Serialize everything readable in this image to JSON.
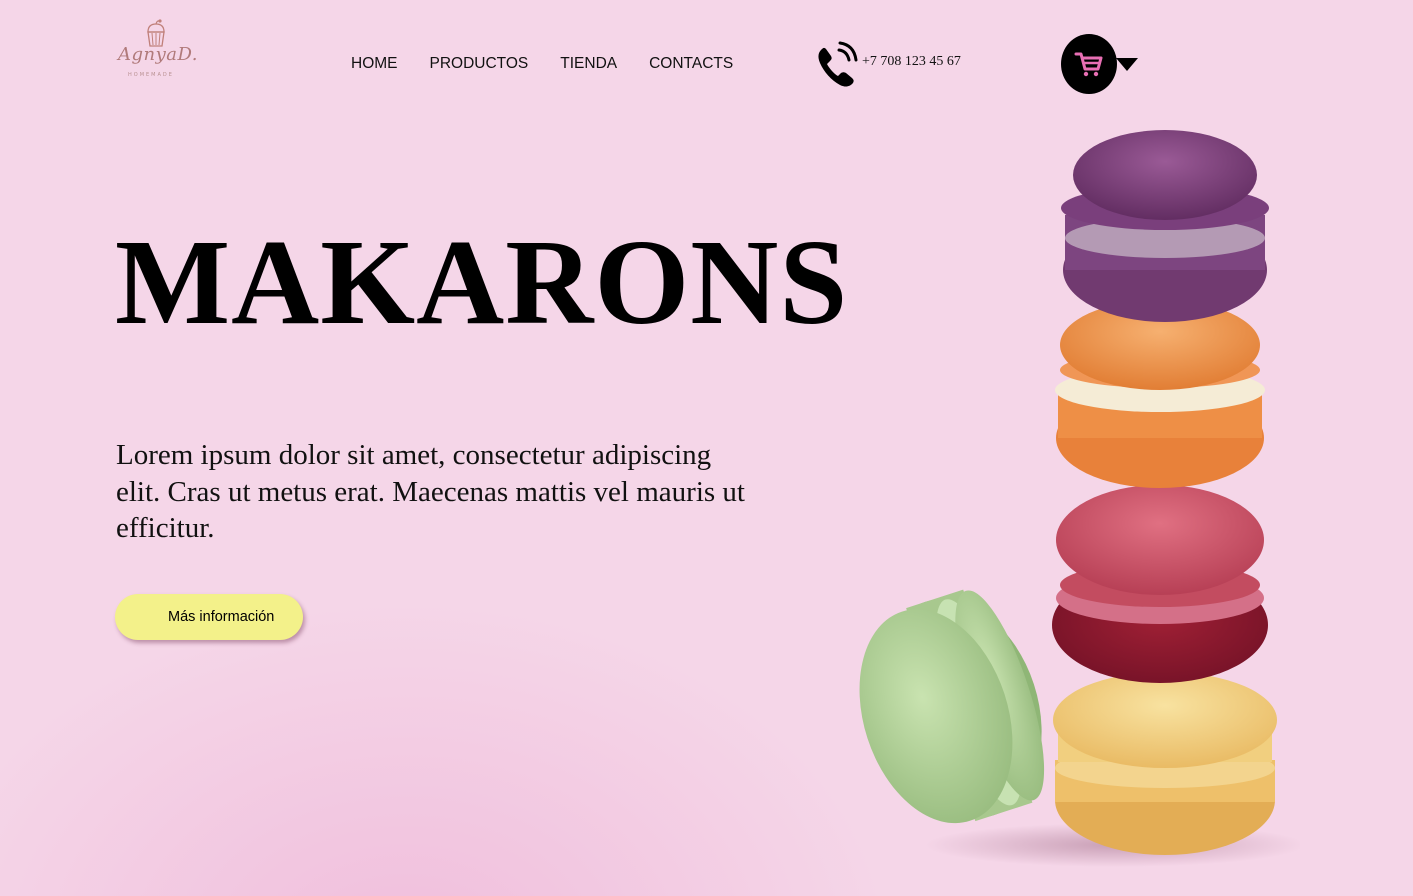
{
  "logo": {
    "brand": "AgnyaD.",
    "tagline": "HOMEMADE",
    "icon": "cupcake-icon"
  },
  "nav": {
    "items": [
      {
        "label": "HOME"
      },
      {
        "label": "PRODUCTOS"
      },
      {
        "label": "TIENDA"
      },
      {
        "label": "CONTACTS"
      }
    ]
  },
  "contact": {
    "phone_icon": "phone-icon",
    "phone_number": "+7 708 123 45 67"
  },
  "cart": {
    "icon": "shopping-cart-icon",
    "dropdown_icon": "caret-down-icon"
  },
  "hero": {
    "title": "MAKARONS",
    "description": "Lorem ipsum dolor sit amet, consectetur adipiscing elit. Cras ut metus erat. Maecenas mattis vel mauris ut efficitur.",
    "button_label": "Más información",
    "image": "macaron-stack"
  },
  "colors": {
    "background": "#f5d6e8",
    "button": "#f3f18a",
    "cart_circle": "#000000",
    "cart_icon": "#e86fb4",
    "text": "#000000"
  }
}
